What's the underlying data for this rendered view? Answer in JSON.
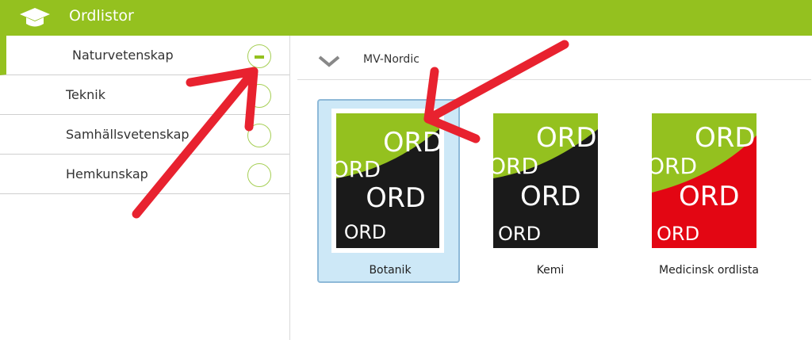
{
  "header": {
    "title": "Ordlistor",
    "icon": "graduation-cap-icon"
  },
  "sidebar": {
    "items": [
      {
        "label": "Naturvetenskap",
        "state": "expanded"
      },
      {
        "label": "Teknik",
        "state": "collapsed"
      },
      {
        "label": "Samhällsvetenskap",
        "state": "collapsed"
      },
      {
        "label": "Hemkunskap",
        "state": "collapsed"
      }
    ]
  },
  "main": {
    "group": {
      "name": "MV-Nordic",
      "icon": "chevron-down-icon"
    },
    "tiles": [
      {
        "name": "Botanik",
        "color": "#1a1a1a",
        "selected": true
      },
      {
        "name": "Kemi",
        "color": "#1a1a1a",
        "selected": false
      },
      {
        "name": "Medicinsk ordlista",
        "color": "#e30613",
        "selected": false
      }
    ],
    "cover_text": "ORD"
  },
  "colors": {
    "accent": "#94c11f",
    "selection": "#cde8f7",
    "annotation": "#e8222f"
  }
}
